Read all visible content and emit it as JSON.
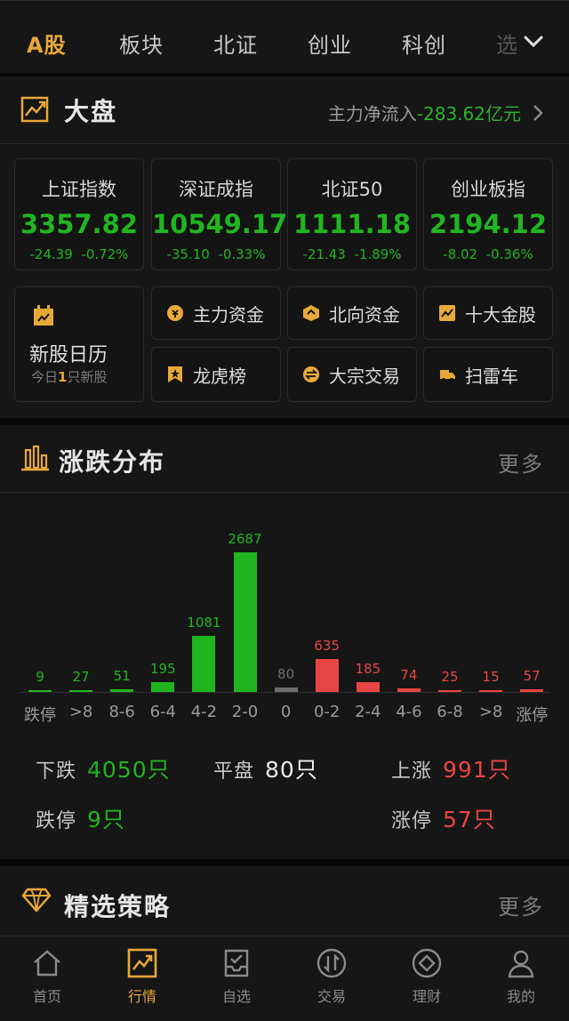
{
  "tabs": [
    "A股",
    "板块",
    "北证",
    "创业",
    "科创",
    "选"
  ],
  "market": {
    "title": "大盘",
    "flow_label": "主力净流入",
    "flow_value": "-283.62亿元",
    "indices": [
      {
        "name": "上证指数",
        "price": "3357.82",
        "change": "-24.39",
        "pct": "-0.72%"
      },
      {
        "name": "深证成指",
        "price": "10549.17",
        "change": "-35.10",
        "pct": "-0.33%"
      },
      {
        "name": "北证50",
        "price": "1111.18",
        "change": "-21.43",
        "pct": "-1.89%"
      },
      {
        "name": "创业板指",
        "price": "2194.12",
        "change": "-8.02",
        "pct": "-0.36%"
      }
    ],
    "calendar": {
      "title": "新股日历",
      "sub_prefix": "今日",
      "sub_count": "1",
      "sub_suffix": "只新股"
    },
    "quick": [
      "主力资金",
      "北向资金",
      "十大金股",
      "龙虎榜",
      "大宗交易",
      "扫雷车"
    ]
  },
  "dist": {
    "title": "涨跌分布",
    "more": "更多",
    "summary": {
      "down_label": "下跌",
      "down_value": "4050只",
      "flat_label": "平盘",
      "flat_value": "80只",
      "up_label": "上涨",
      "up_value": "991只",
      "limitdown_label": "跌停",
      "limitdown_value": "9只",
      "limitup_label": "涨停",
      "limitup_value": "57只"
    }
  },
  "chart_data": {
    "type": "bar",
    "categories": [
      "跌停",
      ">8",
      "8-6",
      "6-4",
      "4-2",
      "2-0",
      "0",
      "0-2",
      "2-4",
      "4-6",
      "6-8",
      ">8",
      "涨停"
    ],
    "values": [
      9,
      27,
      51,
      195,
      1081,
      2687,
      80,
      635,
      185,
      74,
      25,
      15,
      57
    ],
    "labels": [
      "9",
      "27",
      "51",
      "195",
      "1081",
      "2687",
      "80",
      "635",
      "185",
      "74",
      "25",
      "15",
      "57"
    ],
    "colors": [
      "#21b521",
      "#21b521",
      "#21b521",
      "#21b521",
      "#21b521",
      "#21b521",
      "#6e6e6e",
      "#e84545",
      "#e84545",
      "#e84545",
      "#e84545",
      "#e84545",
      "#e84545"
    ],
    "ylim": [
      0,
      2687
    ]
  },
  "strategy": {
    "title": "精选策略",
    "more": "更多"
  },
  "nav": [
    "首页",
    "行情",
    "自选",
    "交易",
    "理财",
    "我的"
  ],
  "colors": {
    "accent": "#e8a83a",
    "down": "#21b521",
    "up": "#e84545"
  }
}
